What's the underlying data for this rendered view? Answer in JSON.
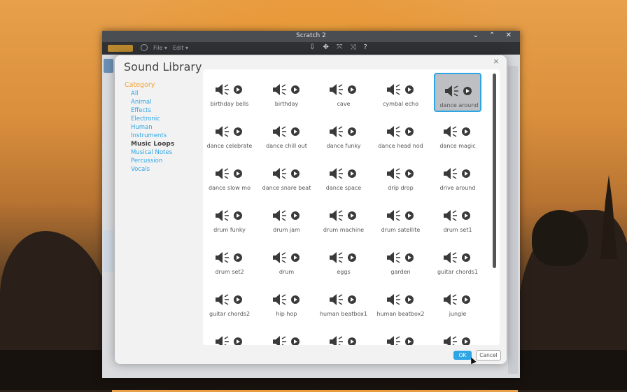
{
  "window": {
    "title": "Scratch 2",
    "controls": "⌄ ⌃ ✕"
  },
  "menubar": {
    "file_label": "File ▾",
    "edit_label": "Edit ▾",
    "toolbar_icons": "⇩ ✥ ⤧ ⤨ ?"
  },
  "dialog": {
    "title": "Sound Library",
    "close_label": "×",
    "ok_label": "OK",
    "cancel_label": "Cancel"
  },
  "categories": {
    "heading": "Category",
    "items": [
      "All",
      "Animal",
      "Effects",
      "Electronic",
      "Human",
      "Instruments",
      "Music Loops",
      "Musical Notes",
      "Percussion",
      "Vocals"
    ],
    "selected": "Music Loops"
  },
  "sounds": [
    "birthday bells",
    "birthday",
    "cave",
    "cymbal echo",
    "dance around",
    "dance celebrate",
    "dance chill out",
    "dance funky",
    "dance head nod",
    "dance magic",
    "dance slow mo",
    "dance snare beat",
    "dance space",
    "drip drop",
    "drive around",
    "drum funky",
    "drum jam",
    "drum machine",
    "drum satellite",
    "drum set1",
    "drum set2",
    "drum",
    "eggs",
    "garden",
    "guitar chords1",
    "guitar chords2",
    "hip hop",
    "human beatbox1",
    "human beatbox2",
    "jungle",
    "",
    "",
    "",
    "",
    ""
  ],
  "selected_sound": "dance around",
  "colors": {
    "accent": "#2ea6e6",
    "category_heading": "#f3a32f"
  }
}
